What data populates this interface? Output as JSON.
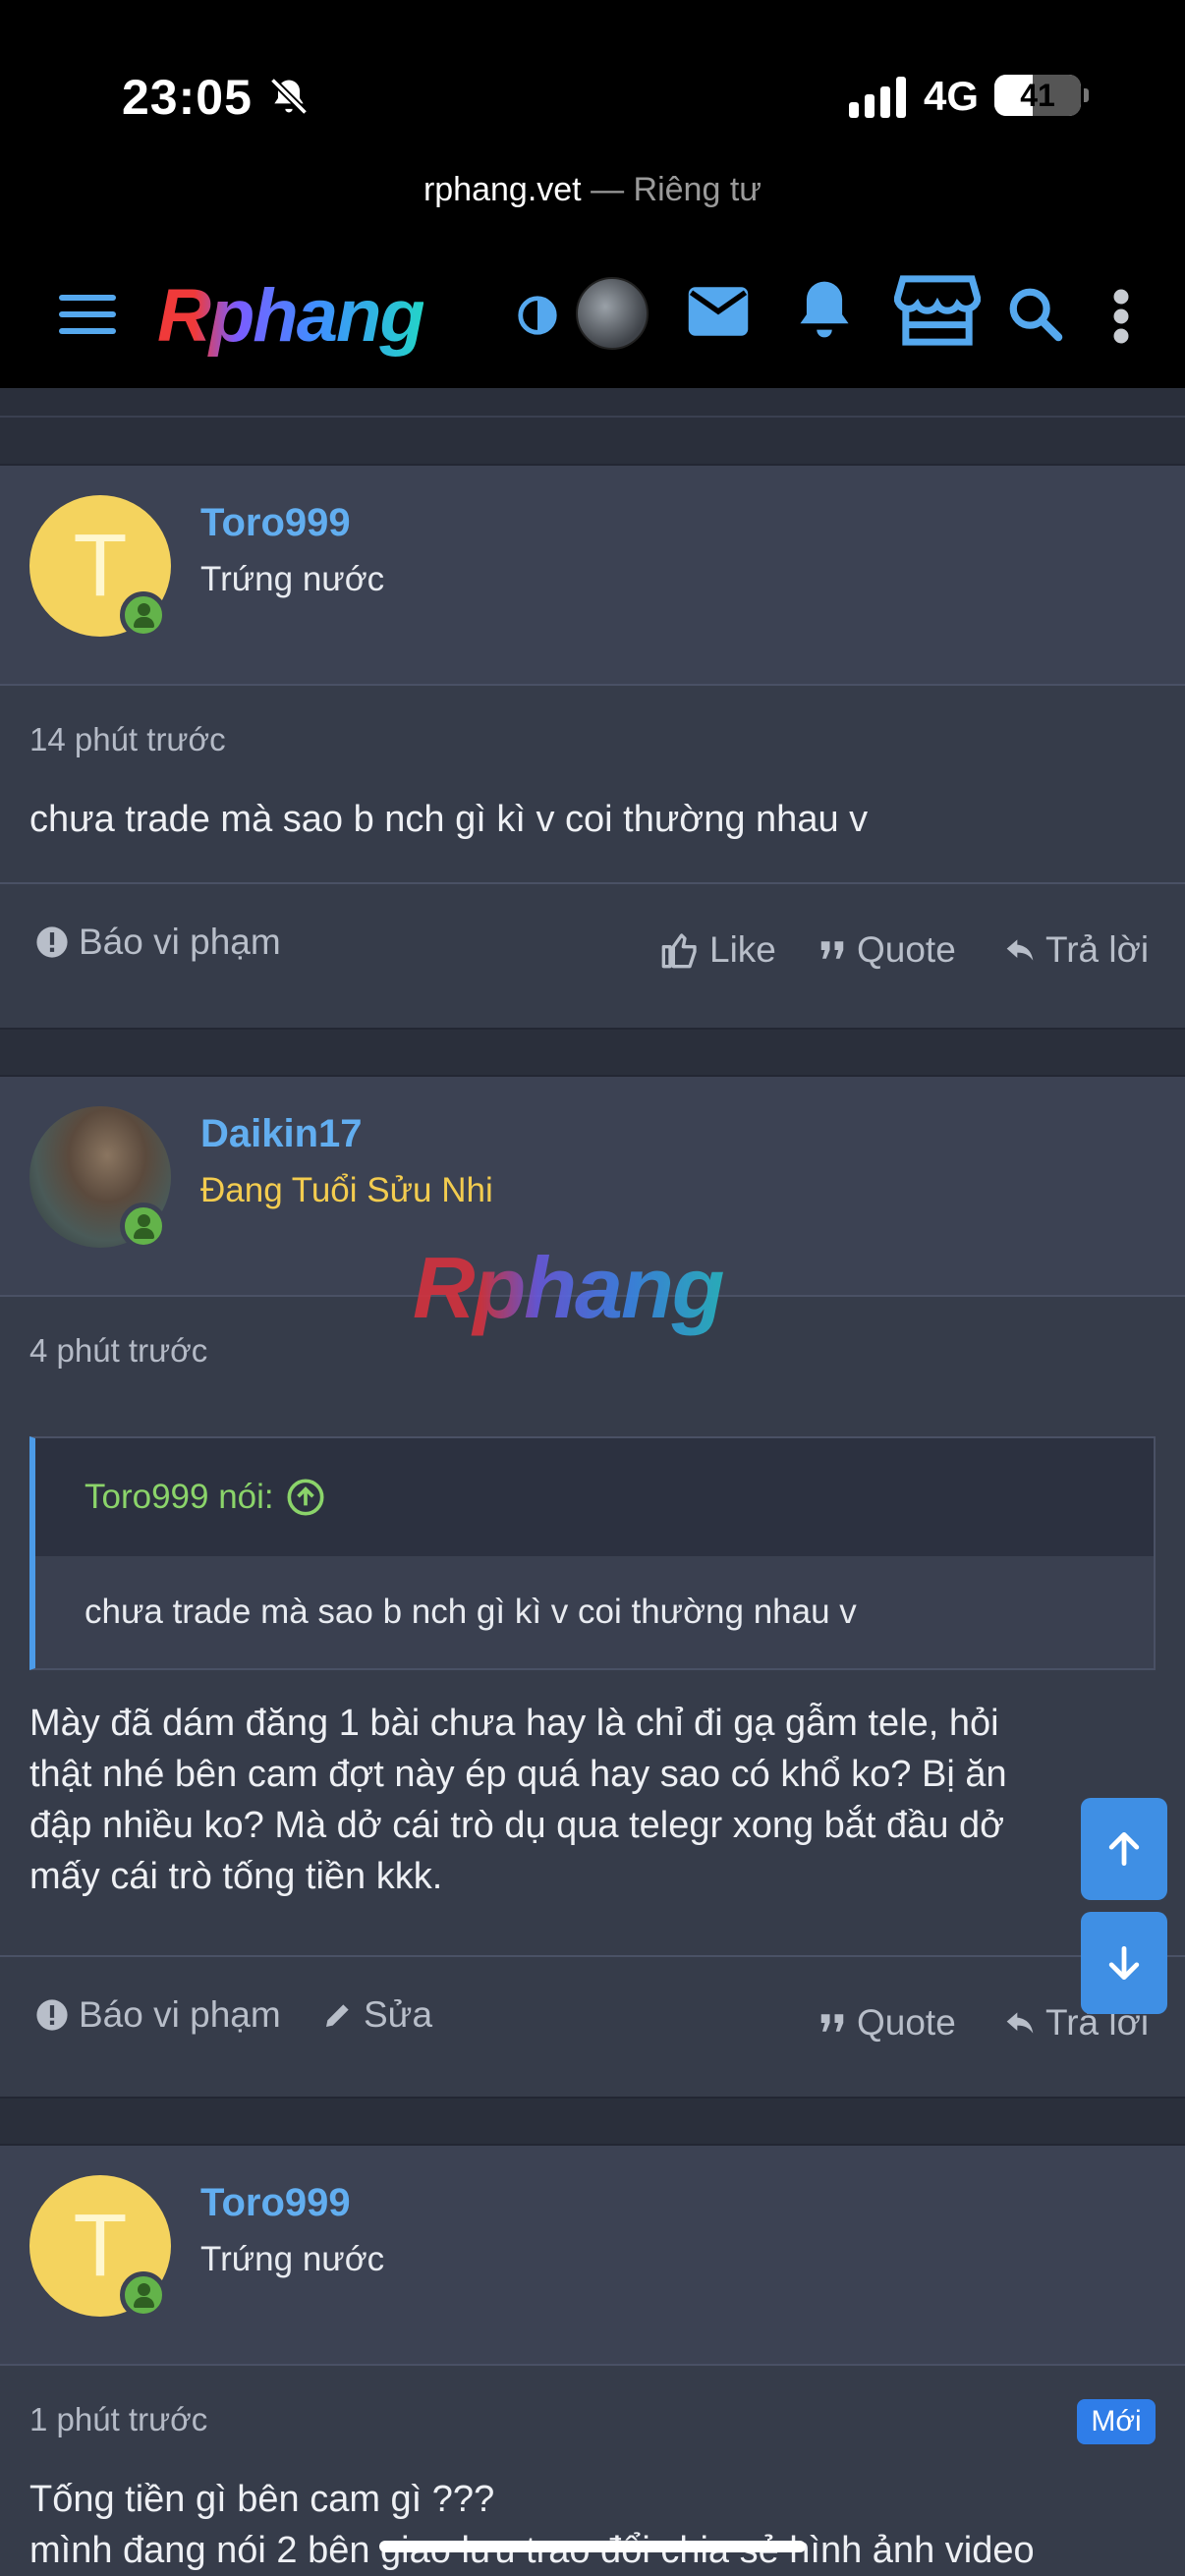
{
  "status_bar": {
    "time": "23:05",
    "network": "4G",
    "battery": "41"
  },
  "browser": {
    "domain": "rphang.vet",
    "separator": "—",
    "mode": "Riêng tư"
  },
  "header": {
    "logo_text": "Rphang",
    "icons": [
      "menu-icon",
      "theme-toggle-icon",
      "avatar",
      "mail-icon",
      "bell-icon",
      "store-icon",
      "search-icon",
      "more-icon"
    ]
  },
  "posts": [
    {
      "username": "Toro999",
      "user_title": "Trứng nước",
      "avatar_letter": "T",
      "time": "14 phút trước",
      "body": "chưa trade mà sao b nch gì kì v coi thường nhau v",
      "actions": {
        "report": "Báo vi phạm",
        "like": "Like",
        "quote": "Quote",
        "reply": "Trả lời"
      }
    },
    {
      "username": "Daikin17",
      "user_title": "Đang Tuổi Sửu Nhi",
      "time": "4 phút trước",
      "quote": {
        "author": "Toro999 nói:",
        "text": "chưa trade mà sao b nch gì kì v coi thường nhau v"
      },
      "body_lines": [
        "Mày đã dám đăng 1 bài chưa hay là chỉ đi gạ gẫm tele, hỏi",
        "thật nhé bên cam đợt này ép quá hay sao có khổ ko? Bị ăn",
        "đập nhiều ko? Mà dở cái trò dụ qua telegr xong bắt đầu dở",
        "mấy cái trò tống tiền kkk."
      ],
      "actions": {
        "report": "Báo vi phạm",
        "edit": "Sửa",
        "quote": "Quote",
        "reply": "Trả lời"
      }
    },
    {
      "username": "Toro999",
      "user_title": "Trứng nước",
      "avatar_letter": "T",
      "time": "1 phút trước",
      "badge": "Mới",
      "body_lines": [
        "Tống tiền gì bên cam gì ???",
        "mình đang nói 2 bên giao lưu trao đổi chia sẻ hình ảnh video"
      ]
    }
  ],
  "watermark": "Rphang",
  "colors": {
    "accent": "#62aef0",
    "online": "#63b34a",
    "title_gold": "#f3cc4f",
    "quote_author": "#8bd46a",
    "badge": "#2f7de8"
  }
}
